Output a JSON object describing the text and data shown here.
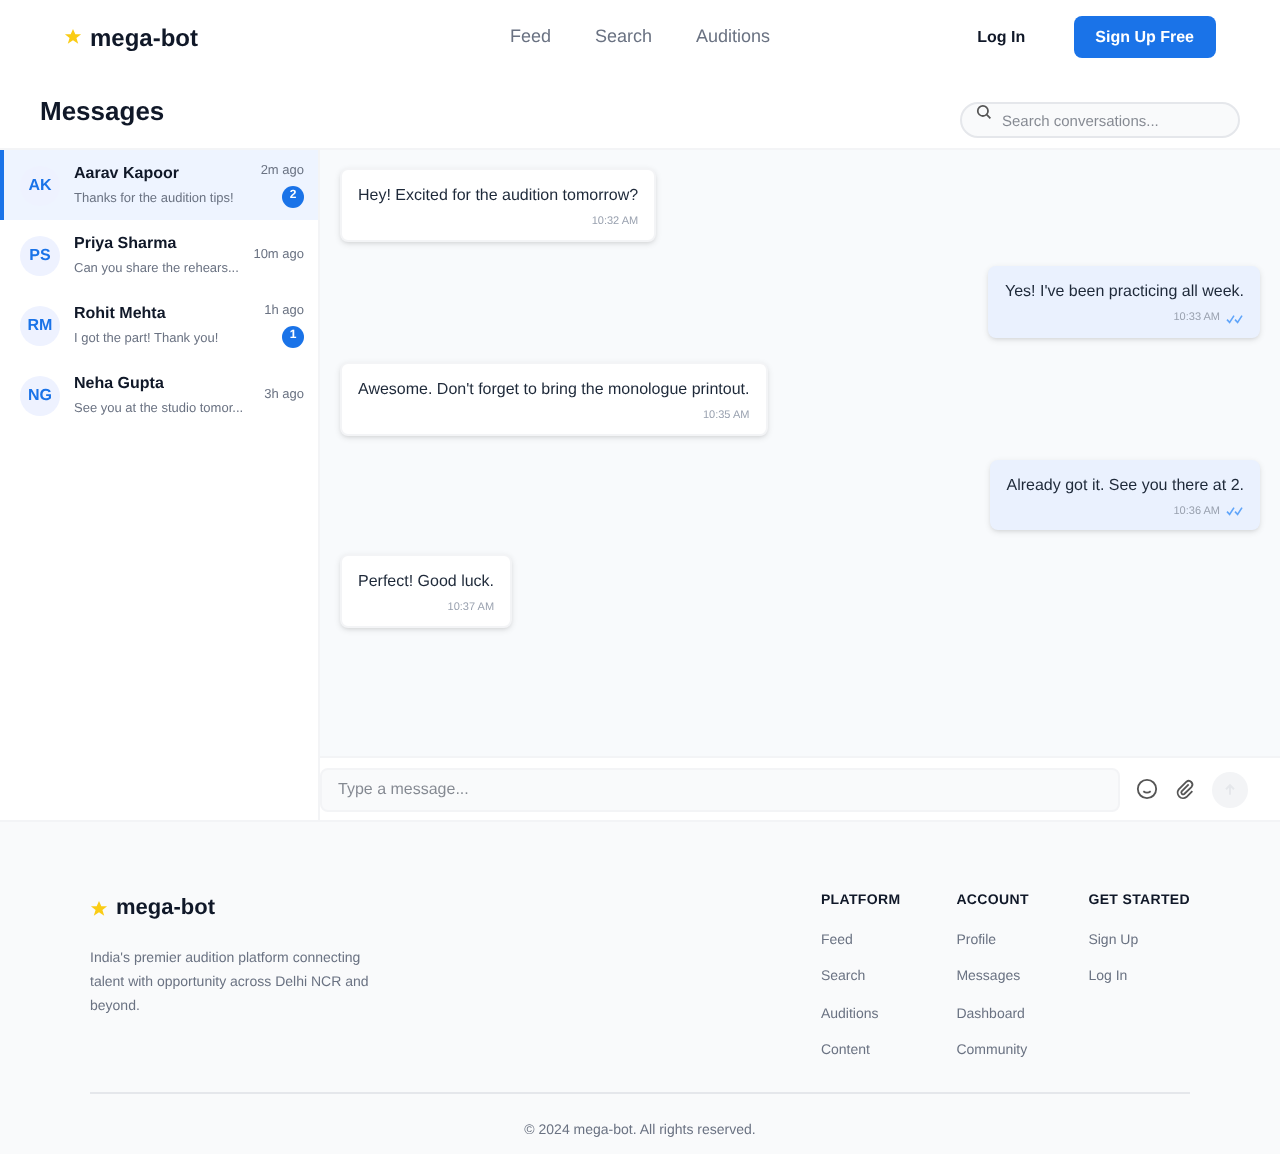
{
  "brand": "mega-bot",
  "nav": [
    {
      "label": "Feed"
    },
    {
      "label": "Search"
    },
    {
      "label": "Auditions"
    }
  ],
  "auth": {
    "login": "Log In",
    "signup": "Sign Up Free"
  },
  "page_title": "Messages",
  "search": {
    "placeholder": "Search conversations..."
  },
  "conversations": [
    {
      "initials": "AK",
      "name": "Aarav Kapoor",
      "preview": "Thanks for the audition tips!",
      "time": "2m ago",
      "unread": "2",
      "selected": true
    },
    {
      "initials": "PS",
      "name": "Priya Sharma",
      "preview": "Can you share the rehears...",
      "time": "10m ago",
      "selected": false
    },
    {
      "initials": "RM",
      "name": "Rohit Mehta",
      "preview": "I got the part! Thank you!",
      "time": "1h ago",
      "unread": "1",
      "selected": false
    },
    {
      "initials": "NG",
      "name": "Neha Gupta",
      "preview": "See you at the studio tomor...",
      "time": "3h ago",
      "selected": false
    }
  ],
  "messages": [
    {
      "text": "Hey! Excited for the audition tomorrow?",
      "time": "10:32 AM",
      "outgoing": false
    },
    {
      "text": "Yes! I've been practicing all week.",
      "time": "10:33 AM",
      "outgoing": true,
      "read": true
    },
    {
      "text": "Awesome. Don't forget to bring the monologue printout.",
      "time": "10:35 AM",
      "outgoing": false
    },
    {
      "text": "Already got it. See you there at 2.",
      "time": "10:36 AM",
      "outgoing": true,
      "read": true
    },
    {
      "text": "Perfect! Good luck.",
      "time": "10:37 AM",
      "outgoing": false
    }
  ],
  "composer": {
    "placeholder": "Type a message..."
  },
  "footer": {
    "brand": "mega-bot",
    "tagline": "India's premier audition platform connecting talent with opportunity across Delhi NCR and beyond.",
    "columns": [
      {
        "heading": "PLATFORM",
        "links": [
          "Feed",
          "Search",
          "Auditions",
          "Content"
        ]
      },
      {
        "heading": "ACCOUNT",
        "links": [
          "Profile",
          "Messages",
          "Dashboard",
          "Community"
        ]
      },
      {
        "heading": "GET STARTED",
        "links": [
          "Sign Up",
          "Log In"
        ]
      }
    ],
    "copyright": "© 2024 mega-bot. All rights reserved."
  }
}
